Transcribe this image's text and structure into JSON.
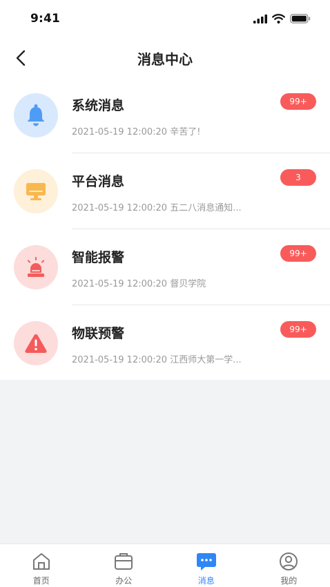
{
  "status_bar": {
    "time": "9:41"
  },
  "header": {
    "title": "消息中心"
  },
  "colors": {
    "accent": "#2f86f6",
    "badge": "#f95b5b"
  },
  "messages": [
    {
      "title": "系统消息",
      "time": "2021-05-19 12:00:20",
      "preview": "辛苦了!",
      "badge": "99+",
      "icon": "bell-icon",
      "icon_color": "#4f9cf6",
      "icon_bg": "#d8e9fd"
    },
    {
      "title": "平台消息",
      "time": "2021-05-19 12:00:20",
      "preview": "五二八消息通知...",
      "badge": "3",
      "icon": "monitor-icon",
      "icon_color": "#f9b84e",
      "icon_bg": "#fef0d9"
    },
    {
      "title": "智能报警",
      "time": "2021-05-19 12:00:20",
      "preview": "督贝学院",
      "badge": "99+",
      "icon": "alarm-light-icon",
      "icon_color": "#f45b5b",
      "icon_bg": "#fddcdc"
    },
    {
      "title": "物联预警",
      "time": "2021-05-19 12:00:20",
      "preview": "江西师大第一学...",
      "badge": "99+",
      "icon": "warning-icon",
      "icon_color": "#f45b5b",
      "icon_bg": "#fddcdc"
    }
  ],
  "tabs": [
    {
      "label": "首页",
      "icon": "home-icon",
      "active": false
    },
    {
      "label": "办公",
      "icon": "briefcase-icon",
      "active": false
    },
    {
      "label": "消息",
      "icon": "message-icon",
      "active": true
    },
    {
      "label": "我的",
      "icon": "user-icon",
      "active": false
    }
  ]
}
